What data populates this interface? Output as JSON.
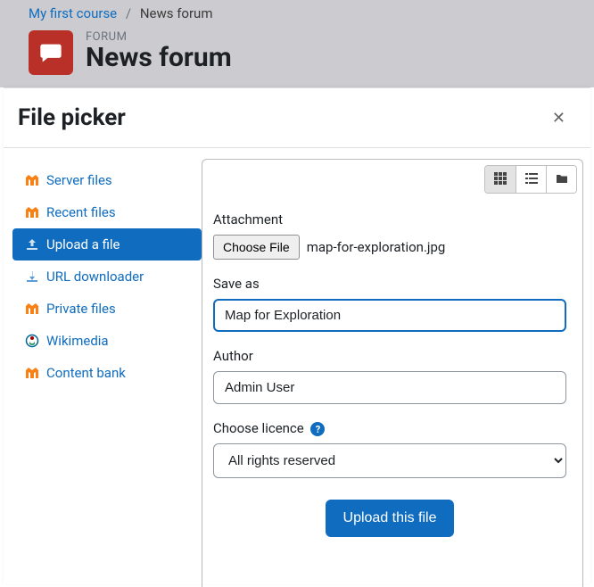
{
  "breadcrumb": {
    "course": "My first course",
    "current": "News forum"
  },
  "forum": {
    "category": "FORUM",
    "title": "News forum"
  },
  "dialog": {
    "title": "File picker"
  },
  "repos": {
    "server": "Server files",
    "recent": "Recent files",
    "upload": "Upload a file",
    "url": "URL downloader",
    "private": "Private files",
    "wikimedia": "Wikimedia",
    "contentbank": "Content bank"
  },
  "form": {
    "attachment_label": "Attachment",
    "choose_button": "Choose File",
    "chosen_filename": "map-for-exploration.jpg",
    "saveas_label": "Save as",
    "saveas_value": "Map for Exploration",
    "author_label": "Author",
    "author_value": "Admin User",
    "licence_label": "Choose licence",
    "licence_value": "All rights reserved",
    "submit_label": "Upload this file"
  }
}
